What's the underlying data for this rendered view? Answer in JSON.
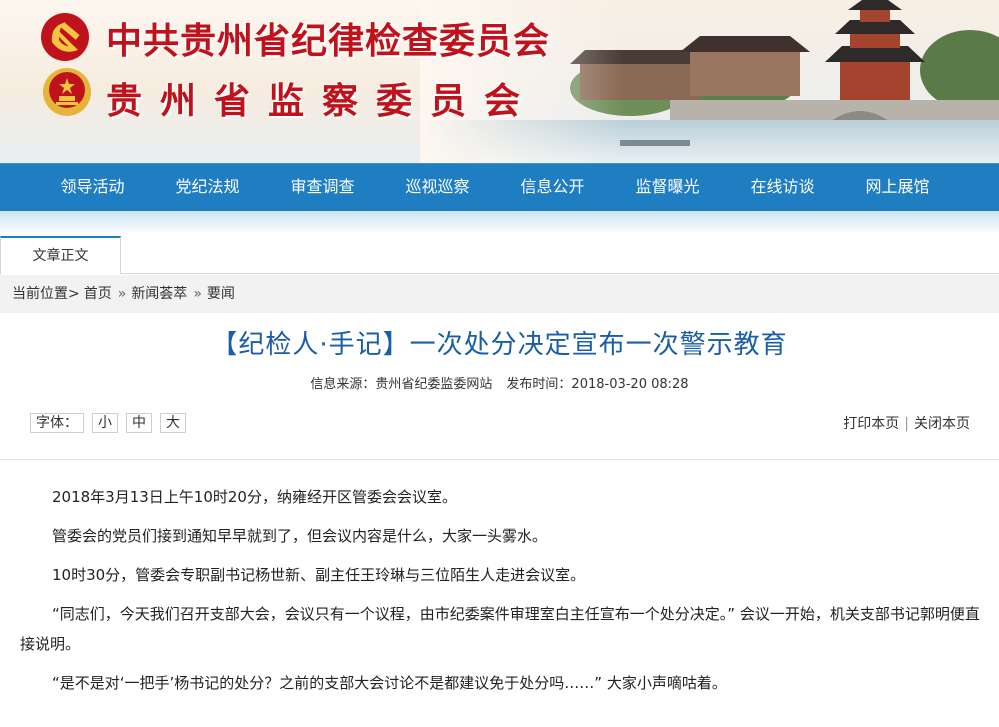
{
  "header": {
    "title_party": "中共贵州省纪律检查委员会",
    "title_state": "贵州省监察委员会",
    "emblem_party_icon": "hammer-sickle-emblem",
    "emblem_state_icon": "national-emblem",
    "brand_red": "#c0121b"
  },
  "nav": {
    "bg_color": "#1f7dc1",
    "items": [
      {
        "label": "领导活动"
      },
      {
        "label": "党纪法规"
      },
      {
        "label": "审查调查"
      },
      {
        "label": "巡视巡察"
      },
      {
        "label": "信息公开"
      },
      {
        "label": "监督曝光"
      },
      {
        "label": "在线访谈"
      },
      {
        "label": "网上展馆"
      }
    ]
  },
  "tab": {
    "label": "文章正文"
  },
  "breadcrumb": {
    "label": "当前位置>",
    "items": [
      "首页",
      "新闻荟萃",
      "要闻"
    ],
    "separator": "»"
  },
  "article": {
    "title": "【纪检人·手记】一次处分决定宣布一次警示教育",
    "source": "信息来源：贵州省纪委监委网站",
    "published": "发布时间：2018-03-20 08:28",
    "font_label": "字体：",
    "font_small": "小",
    "font_medium": "中",
    "font_large": "大",
    "print_label": "打印本页",
    "close_label": "关闭本页",
    "paragraphs": [
      "2018年3月13日上午10时20分，纳雍经开区管委会会议室。",
      "管委会的党员们接到通知早早就到了，但会议内容是什么，大家一头雾水。",
      "10时30分，管委会专职副书记杨世新、副主任王玲琳与三位陌生人走进会议室。",
      "“同志们，今天我们召开支部大会，会议只有一个议程，由市纪委案件审理室白主任宣布一个处分决定。” 会议一开始，机关支部书记郭明便直接说明。",
      "“是不是对‘一把手’杨书记的处分？之前的支部大会讨论不是都建议免于处分吗……” 大家小声嘀咕着。"
    ]
  }
}
